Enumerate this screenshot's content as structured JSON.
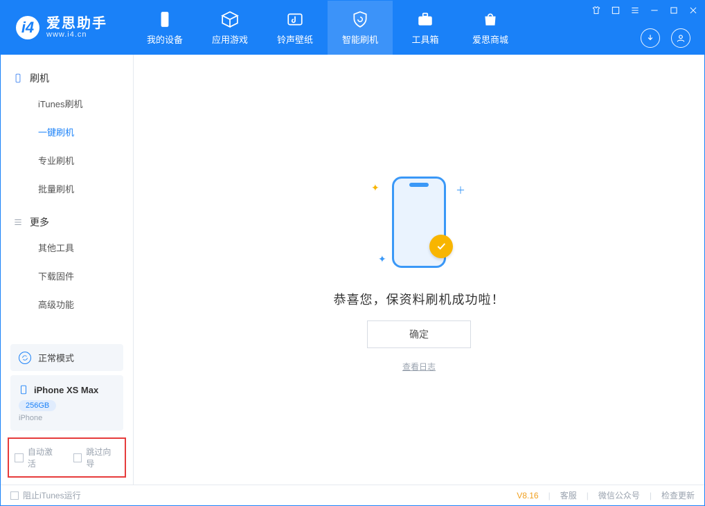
{
  "app": {
    "name_cn": "爱思助手",
    "url": "www.i4.cn"
  },
  "nav": {
    "my_device": "我的设备",
    "apps_games": "应用游戏",
    "ring_wall": "铃声壁纸",
    "smart_flash": "智能刷机",
    "toolbox": "工具箱",
    "store": "爱思商城"
  },
  "sidebar": {
    "group_flash": "刷机",
    "itunes_flash": "iTunes刷机",
    "one_key_flash": "一键刷机",
    "pro_flash": "专业刷机",
    "batch_flash": "批量刷机",
    "group_more": "更多",
    "other_tools": "其他工具",
    "download_fw": "下载固件",
    "advanced": "高级功能"
  },
  "mode": {
    "label": "正常模式"
  },
  "device": {
    "name": "iPhone XS Max",
    "capacity": "256GB",
    "type": "iPhone"
  },
  "checks": {
    "auto_activate": "自动激活",
    "skip_guide": "跳过向导"
  },
  "main": {
    "success_text": "恭喜您，保资料刷机成功啦！",
    "ok": "确定",
    "view_log": "查看日志"
  },
  "status": {
    "block_itunes": "阻止iTunes运行",
    "version": "V8.16",
    "service": "客服",
    "wechat": "微信公众号",
    "check_update": "检查更新"
  }
}
